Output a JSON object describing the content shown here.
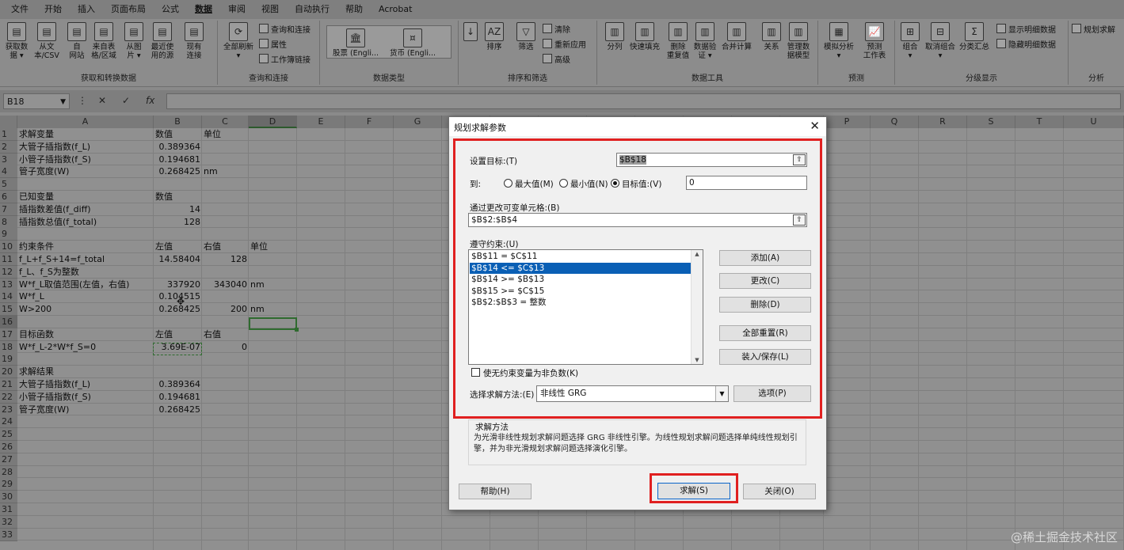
{
  "menu": [
    "文件",
    "开始",
    "插入",
    "页面布局",
    "公式",
    "数据",
    "审阅",
    "视图",
    "自动执行",
    "帮助",
    "Acrobat"
  ],
  "menu_active": "数据",
  "ribbon": {
    "get_data": {
      "group": "获取和转换数据",
      "buttons": [
        {
          "line1": "获取数",
          "line2": "据 ▾",
          "icon": "database-icon"
        },
        {
          "line1": "从文",
          "line2": "本/CSV",
          "icon": "text-file-icon"
        },
        {
          "line1": "自",
          "line2": "网站",
          "icon": "web-icon"
        },
        {
          "line1": "来自表",
          "line2": "格/区域",
          "icon": "table-icon"
        },
        {
          "line1": "从图",
          "line2": "片 ▾",
          "icon": "picture-icon"
        },
        {
          "line1": "最近使",
          "line2": "用的源",
          "icon": "recent-sources-icon"
        },
        {
          "line1": "现有",
          "line2": "连接",
          "icon": "existing-connections-icon"
        }
      ]
    },
    "queries": {
      "group": "查询和连接",
      "refresh": {
        "line1": "全部刷新",
        "line2": "▾"
      },
      "small": [
        "查询和连接",
        "属性",
        "工作簿链接"
      ]
    },
    "data_types": {
      "group": "数据类型",
      "stocks": "股票 (Engli...",
      "currency": "货币 (Engli..."
    },
    "sort_filter": {
      "group": "排序和筛选",
      "sort": "排序",
      "filter": "筛选",
      "small": [
        "清除",
        "重新应用",
        "高级"
      ]
    },
    "data_tools": {
      "group": "数据工具",
      "buttons": [
        {
          "line1": "分列",
          "line2": ""
        },
        {
          "line1": "快速填充",
          "line2": ""
        },
        {
          "line1": "删除",
          "line2": "重复值"
        },
        {
          "line1": "数据验",
          "line2": "证 ▾"
        },
        {
          "line1": "合并计算",
          "line2": ""
        },
        {
          "line1": "关系",
          "line2": ""
        },
        {
          "line1": "管理数",
          "line2": "据模型"
        }
      ]
    },
    "forecast": {
      "group": "预测",
      "buttons": [
        {
          "line1": "模拟分析",
          "line2": "▾"
        },
        {
          "line1": "预测",
          "line2": "工作表"
        }
      ]
    },
    "outline": {
      "group": "分级显示",
      "buttons": [
        {
          "line1": "组合",
          "line2": "▾"
        },
        {
          "line1": "取消组合",
          "line2": "▾"
        },
        {
          "line1": "分类汇总",
          "line2": ""
        }
      ],
      "small": [
        "显示明细数据",
        "隐藏明细数据"
      ]
    },
    "analysis": {
      "group": "分析",
      "solver": "规划求解"
    }
  },
  "formula_bar": {
    "name_box": "B18",
    "fx": "fx",
    "value": ""
  },
  "columns": [
    "A",
    "B",
    "C",
    "D",
    "E",
    "F",
    "G",
    "H",
    "I",
    "J",
    "K",
    "L",
    "M",
    "N",
    "O",
    "P",
    "Q",
    "R",
    "S",
    "T",
    "U"
  ],
  "rows": [
    "1",
    "2",
    "3",
    "4",
    "5",
    "6",
    "7",
    "8",
    "9",
    "10",
    "11",
    "12",
    "13",
    "14",
    "15",
    "16",
    "17",
    "18",
    "19",
    "20",
    "21",
    "22",
    "23",
    "24",
    "25",
    "26",
    "27",
    "28",
    "29",
    "30",
    "31",
    "32",
    "33"
  ],
  "cells": {
    "A1": "求解变量",
    "B1": "数值",
    "C1": "单位",
    "A2": "大管子插指数(f_L)",
    "B2": "0.389364",
    "A3": "小管子插指数(f_S)",
    "B3": "0.194681",
    "A4": "管子宽度(W)",
    "B4": "0.268425",
    "C4": "nm",
    "A6": "已知变量",
    "B6": "数值",
    "A7": "插指数差值(f_diff)",
    "B7": "14",
    "A8": "插指数总值(f_total)",
    "B8": "128",
    "A10": "约束条件",
    "B10": "左值",
    "C10": "右值",
    "D10": "单位",
    "A11": "f_L+f_S+14=f_total",
    "B11": "14.58404",
    "C11": "128",
    "A12": "f_L、f_S为整数",
    "A13": "W*f_L取值范围(左值，右值)",
    "B13": "337920",
    "C13": "343040",
    "D13": "nm",
    "A14": "W*f_L",
    "B14": "0.104515",
    "A15": "W>200",
    "B15": "0.268425",
    "C15": "200",
    "D15": "nm",
    "A17": "目标函数",
    "B17": "左值",
    "C17": "右值",
    "A18": "W*f_L-2*W*f_S=0",
    "B18": "3.69E-07",
    "C18": "0",
    "A20": "求解结果",
    "A21": "大管子插指数(f_L)",
    "B21": "0.389364",
    "A22": "小管子插指数(f_S)",
    "B22": "0.194681",
    "A23": "管子宽度(W)",
    "B23": "0.268425"
  },
  "dialog": {
    "title": "规划求解参数",
    "set_objective_label": "设置目标:(T)",
    "set_objective_value": "$B$18",
    "to_label": "到:",
    "radio_max": "最大值(M)",
    "radio_min": "最小值(N)",
    "radio_value": "目标值:(V)",
    "target_value": "0",
    "changing_cells_label": "通过更改可变单元格:(B)",
    "changing_cells_value": "$B$2:$B$4",
    "constraints_label": "遵守约束:(U)",
    "constraints": [
      "$B$11 = $C$11",
      "$B$14 <= $C$13",
      "$B$14 >= $B$13",
      "$B$15 >= $C$15",
      "$B$2:$B$3 = 整数"
    ],
    "selected_constraint": 1,
    "btn_add": "添加(A)",
    "btn_change": "更改(C)",
    "btn_delete": "删除(D)",
    "btn_reset_all": "全部重置(R)",
    "btn_load_save": "装入/保存(L)",
    "nonneg_label": "使无约束变量为非负数(K)",
    "method_label": "选择求解方法:(E)",
    "method_value": "非线性 GRG",
    "btn_options": "选项(P)",
    "method_group_title": "求解方法",
    "method_desc": "为光滑非线性规划求解问题选择 GRG 非线性引擎。为线性规划求解问题选择单纯线性规划引擎，并为非光滑规划求解问题选择演化引擎。",
    "btn_help": "帮助(H)",
    "btn_solve": "求解(S)",
    "btn_close": "关闭(O)"
  },
  "watermark": "@稀土掘金技术社区",
  "colors": {
    "highlight_red": "#e02020",
    "selection_blue": "#0a5fb5",
    "selection_green": "#2f6b2f"
  }
}
